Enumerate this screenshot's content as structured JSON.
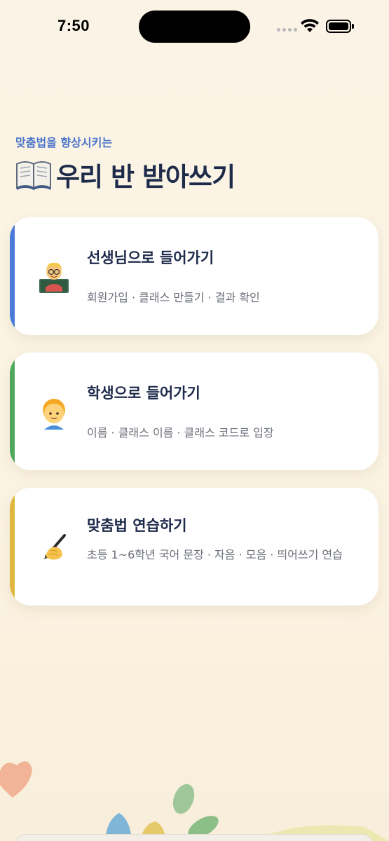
{
  "status_bar": {
    "time": "7:50"
  },
  "header": {
    "subtitle": "맞춤법을 향상시키는",
    "title": "우리 반 받아쓰기",
    "icon": "book-icon"
  },
  "cards": [
    {
      "title": "선생님으로 들어가기",
      "description": "회원가입 · 클래스 만들기 · 결과 확인",
      "icon": "teacher-icon",
      "accent": "#4a7bd9"
    },
    {
      "title": "학생으로 들어가기",
      "description": "이름 · 클래스 이름 · 클래스 코드로 입장",
      "icon": "student-icon",
      "accent": "#4fa85e"
    },
    {
      "title": "맞춤법 연습하기",
      "description": "초등 1~6학년 국어 문장 · 자음 · 모음 · 띄어쓰기 연습",
      "icon": "writing-hand-icon",
      "accent": "#e0b73e"
    }
  ],
  "colors": {
    "background": "#fbf4e6",
    "title": "#1d2a4a",
    "subtitle": "#4a74c9"
  }
}
